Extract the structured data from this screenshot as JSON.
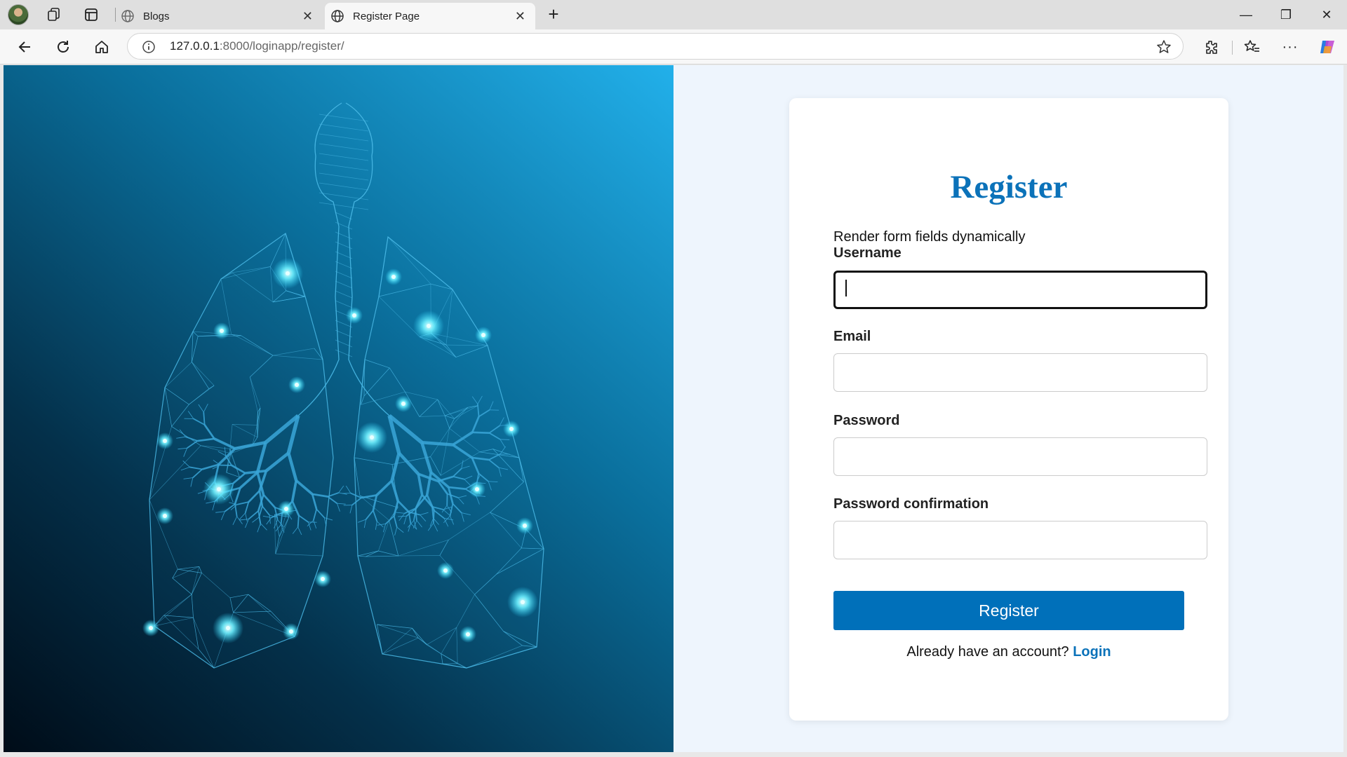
{
  "browser": {
    "tabs": [
      {
        "label": "Blogs",
        "active": false
      },
      {
        "label": "Register Page",
        "active": true
      }
    ],
    "address": {
      "host": "127.0.0.1",
      "path": ":8000/loginapp/register/"
    }
  },
  "form": {
    "title": "Register",
    "note": "Render form fields dynamically",
    "fields": [
      {
        "label": "Username",
        "value": ""
      },
      {
        "label": "Email",
        "value": ""
      },
      {
        "label": "Password",
        "value": ""
      },
      {
        "label": "Password confirmation",
        "value": ""
      }
    ],
    "submit_label": "Register",
    "footer_text": "Already have an account?",
    "login_link": "Login"
  },
  "colors": {
    "accent": "#0b72b9",
    "button": "#0070ba",
    "page_bg": "#eef5fd"
  },
  "icons": [
    "profile-avatar-icon",
    "collections-icon",
    "tab-actions-icon",
    "globe-icon",
    "close-icon",
    "plus-icon",
    "minimize-icon",
    "restore-icon",
    "back-icon",
    "refresh-icon",
    "home-icon",
    "info-icon",
    "star-icon",
    "extensions-icon",
    "favorites-icon",
    "more-icon",
    "copilot-icon",
    "lungs-illustration"
  ]
}
